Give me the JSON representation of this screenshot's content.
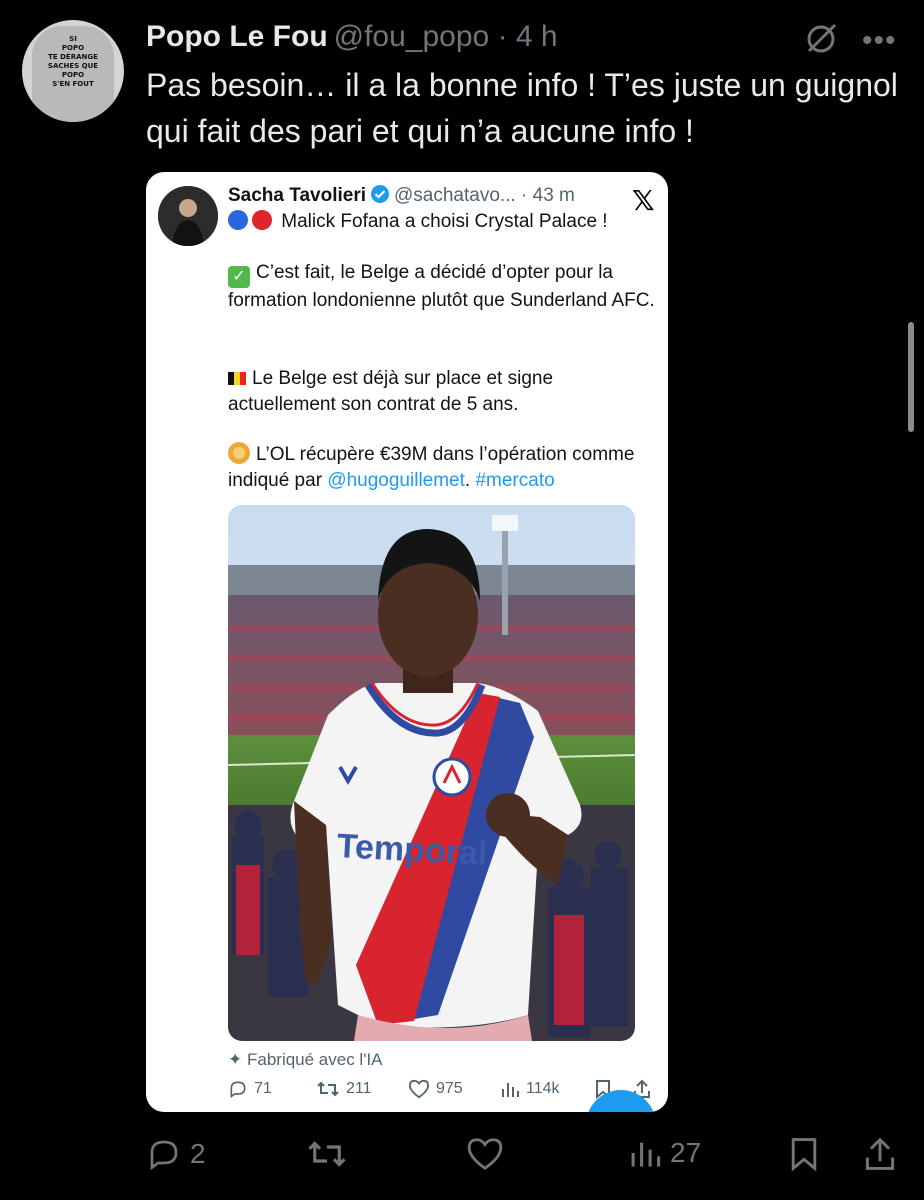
{
  "tweet": {
    "display_name": "Popo Le Fou",
    "handle": "@fou_popo",
    "time": "· 4 h",
    "text": "Pas besoin… il a la bonne info ! T’es juste un guignol qui fait des pari et qui n’a aucune info !",
    "avatar_text": "SI\nPOPO\nTE DÉRANGE\nSACHES QUE\nPOPO\nS'EN FOUT",
    "more_icon": "more-dots-icon",
    "grok_icon": "grok-icon",
    "stats": {
      "replies": "2",
      "retweets": "",
      "likes": "",
      "views": "27"
    }
  },
  "quoted": {
    "display_name": "Sacha Tavolieri",
    "handle": "@sachatavo...",
    "time": "· 43 m",
    "headline": "Malick Fofana a choisi Crystal Palace !",
    "para1": "C’est fait, le Belge a décidé d’opter pour la formation londonienne plutôt que Sunderland AFC.",
    "para2": "Le Belge est déjà sur place et signe actuellement son contrat de 5 ans.",
    "para3_text": "L’OL récupère €39M dans l’opération comme indiqué par",
    "para3_mention": "@hugoguillemet",
    "para3_sep": ".",
    "para3_hashtag": "#mercato",
    "photo_sponsor": "Temporal",
    "ai_label": "Fabriqué avec l'IA",
    "stats": {
      "replies": "71",
      "retweets": "211",
      "likes": "975",
      "views": "114k"
    }
  },
  "colors": {
    "background": "#000000",
    "text": "#e7e9ea",
    "muted": "#71767b",
    "link": "#1d9bf0",
    "card": "#ffffff"
  }
}
